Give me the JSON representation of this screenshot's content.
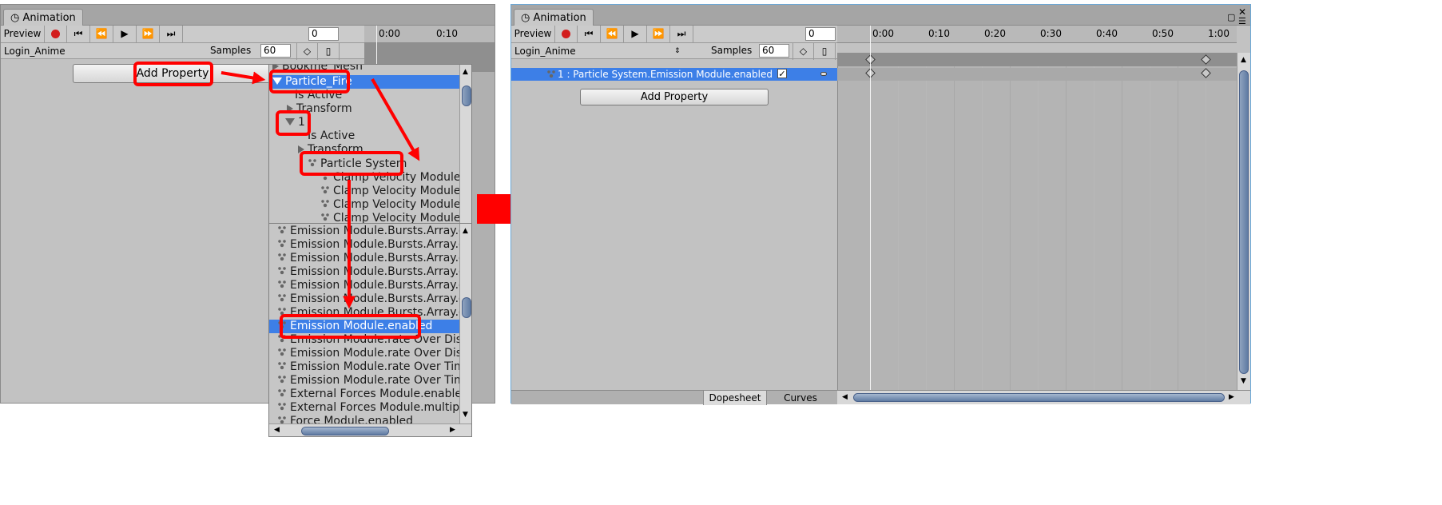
{
  "left_window": {
    "tab": "Animation",
    "toolbar": {
      "preview": "Preview",
      "frame": "0"
    },
    "ruler": [
      "0:00",
      "0:10"
    ],
    "clip": "Login_Anime",
    "samples_label": "Samples",
    "samples_value": "60",
    "add_property": "Add Property"
  },
  "popup_top": {
    "rows": [
      {
        "label": "Bookme_Mesh"
      },
      {
        "label": "Particle_Fire"
      },
      {
        "label": "Is Active"
      },
      {
        "label": "Transform"
      },
      {
        "label": "1"
      },
      {
        "label": "Is Active"
      },
      {
        "label": "Transform"
      },
      {
        "label": "Particle System"
      },
      {
        "label": "Clamp Velocity Module.da"
      },
      {
        "label": "Clamp Velocity Module.dr"
      },
      {
        "label": "Clamp Velocity Module.dr"
      },
      {
        "label": "Clamp Velocity Module.en"
      }
    ]
  },
  "popup_bottom": {
    "rows": [
      {
        "label": "Emission Module.Bursts.Array.data"
      },
      {
        "label": "Emission Module.Bursts.Array.data"
      },
      {
        "label": "Emission Module.Bursts.Array.data"
      },
      {
        "label": "Emission Module.Bursts.Array.data"
      },
      {
        "label": "Emission Module.Bursts.Array.data"
      },
      {
        "label": "Emission Module.Bursts.Array.data"
      },
      {
        "label": "Emission Module.Bursts.Array.data"
      },
      {
        "label": "Emission Module.enabled"
      },
      {
        "label": "Emission Module.rate Over Distanc"
      },
      {
        "label": "Emission Module.rate Over Distanc"
      },
      {
        "label": "Emission Module.rate Over Time.m"
      },
      {
        "label": "Emission Module.rate Over Time.s"
      },
      {
        "label": "External Forces Module.enabled"
      },
      {
        "label": "External Forces Module.multiplier"
      },
      {
        "label": "Force Module.enabled"
      }
    ]
  },
  "right_window": {
    "tab": "Animation",
    "toolbar": {
      "preview": "Preview",
      "frame": "0"
    },
    "ruler": [
      "0:00",
      "0:10",
      "0:20",
      "0:30",
      "0:40",
      "0:50",
      "1:00"
    ],
    "clip": "Login_Anime",
    "samples_label": "Samples",
    "samples_value": "60",
    "property": "1 : Particle System.Emission Module.enabled",
    "add_property": "Add Property",
    "tabs": {
      "dopesheet": "Dopesheet",
      "curves": "Curves"
    }
  },
  "colors": {
    "highlight": "#ff0000",
    "selection": "#3d7fe7",
    "record": "#d21c1c"
  }
}
